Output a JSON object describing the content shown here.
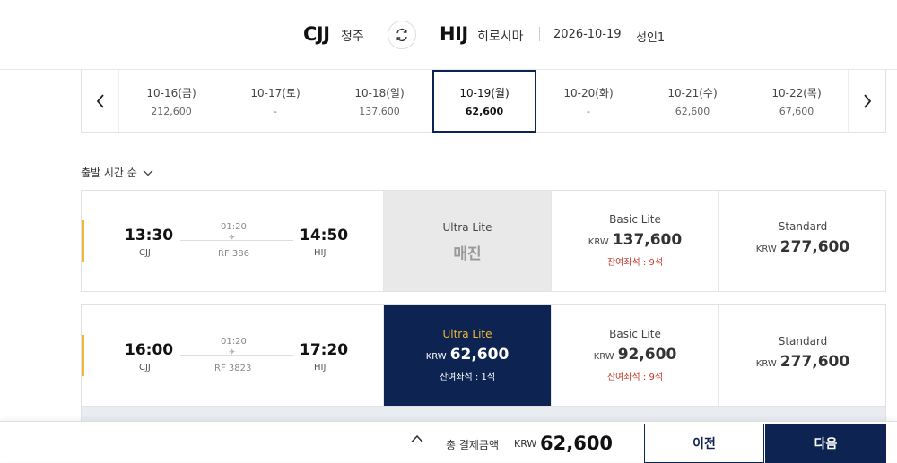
{
  "route": {
    "origin_code": "CJJ",
    "origin_city": "청주",
    "dest_code": "HIJ",
    "dest_city": "히로시마",
    "date": "2026-10-19",
    "passengers": "성인1"
  },
  "dates": [
    {
      "label": "10-16(금)",
      "price": "212,600",
      "selected": false
    },
    {
      "label": "10-17(토)",
      "price": "-",
      "selected": false
    },
    {
      "label": "10-18(일)",
      "price": "137,600",
      "selected": false
    },
    {
      "label": "10-19(월)",
      "price": "62,600",
      "selected": true
    },
    {
      "label": "10-20(화)",
      "price": "-",
      "selected": false
    },
    {
      "label": "10-21(수)",
      "price": "62,600",
      "selected": false
    },
    {
      "label": "10-22(목)",
      "price": "67,600",
      "selected": false
    }
  ],
  "sort": {
    "label": "출발 시간 순"
  },
  "flights": [
    {
      "dep_time": "13:30",
      "dep_apt": "CJJ",
      "arr_time": "14:50",
      "arr_apt": "HIJ",
      "duration": "01:20",
      "flight_no": "RF 386",
      "fares": {
        "ultra": {
          "name": "Ultra Lite",
          "status": "매진"
        },
        "basic": {
          "name": "Basic Lite",
          "currency": "KRW",
          "price": "137,600",
          "seats": "잔여좌석 : 9석"
        },
        "standard": {
          "name": "Standard",
          "currency": "KRW",
          "price": "277,600"
        }
      }
    },
    {
      "dep_time": "16:00",
      "dep_apt": "CJJ",
      "arr_time": "17:20",
      "arr_apt": "HIJ",
      "duration": "01:20",
      "flight_no": "RF 3823",
      "fares": {
        "ultra": {
          "name": "Ultra Lite",
          "currency": "KRW",
          "price": "62,600",
          "seats": "잔여좌석 : 1석"
        },
        "basic": {
          "name": "Basic Lite",
          "currency": "KRW",
          "price": "92,600",
          "seats": "잔여좌석 : 9석"
        },
        "standard": {
          "name": "Standard",
          "currency": "KRW",
          "price": "277,600"
        }
      }
    }
  ],
  "footer": {
    "total_label": "총 결제금액",
    "currency": "KRW",
    "total": "62,600",
    "prev_label": "이전",
    "next_label": "다음"
  },
  "colors": {
    "navy": "#0d2452",
    "accent_yellow": "#f2b632",
    "seats_red": "#c0392b"
  },
  "icons": [
    "swap-icon",
    "chevron-left-icon",
    "chevron-right-icon",
    "chevron-down-icon",
    "plane-icon",
    "chevron-up-icon"
  ]
}
